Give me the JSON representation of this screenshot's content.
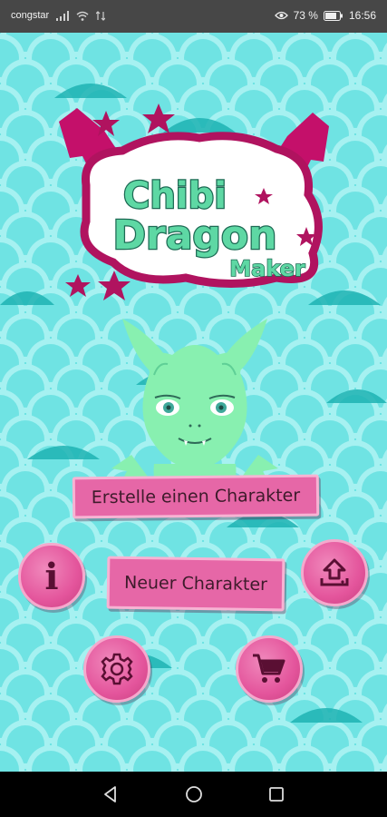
{
  "status_bar": {
    "carrier": "congstar",
    "battery": "73 %",
    "time": "16:56",
    "icons": [
      "signal-icon",
      "wifi-icon",
      "data-icon",
      "eye-comfort-icon",
      "battery-icon"
    ]
  },
  "logo": {
    "line1": "Chibi",
    "line2": "Dragon",
    "line3": "Maker"
  },
  "buttons": {
    "create_label": "Erstelle einen Charakter",
    "new_label": "Neuer Charakter",
    "info_label": "i"
  },
  "colors": {
    "background": "#6fe3e3",
    "scale_dark": "#1fb3b3",
    "scale_light": "#a6f1f1",
    "accent_pink": "#e667a7",
    "dark_magenta": "#b0135f",
    "dragon_green": "#88f0b0"
  },
  "nav": {
    "icons": [
      "back-icon",
      "home-icon",
      "recent-apps-icon"
    ]
  }
}
